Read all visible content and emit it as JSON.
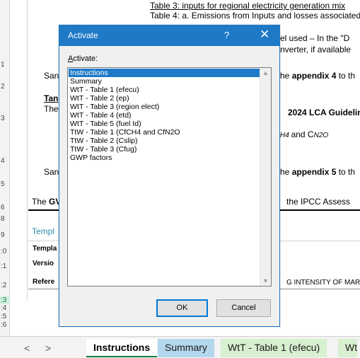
{
  "sheet": {
    "row_numbers": [
      "1",
      "2",
      "3",
      "4",
      "5",
      "6",
      "8",
      "9",
      ":0",
      ":1",
      ":2",
      ":3",
      ":4",
      ":5",
      ":6"
    ],
    "selected_row": ":3",
    "lines": {
      "table3": "Table 3: inputs for regional electricity generation mix",
      "table4": "Table 4: a. Emissions from Inputs and losses associated",
      "fuel_used": "el used – In the \"D",
      "converter": "nverter, if available",
      "san1": "San",
      "appendix4_prefix": "he ",
      "appendix4_bold": "appendix 4",
      "appendix4_suffix": " to th",
      "tan": "Tan",
      "the": "The",
      "lca": "2024 LCA Guidelin",
      "ch4_prefix": "",
      "ch4_text": "and C",
      "ch4_sub1": "H4",
      "ch4_sub2": "N2O",
      "san2": "San",
      "appendix5_prefix": "he ",
      "appendix5_bold": "appendix 5",
      "appendix5_suffix": " to th",
      "the_gv_prefix": "The ",
      "the_gv_bold": "GV",
      "ipcc": "the IPCC Assess",
      "templ": "Templ",
      "templa": "Templa",
      "versio": "Versio",
      "refere": "Refere",
      "intensity": "G INTENSITY OF MARIN"
    }
  },
  "dialog": {
    "title": "Activate",
    "help_label": "?",
    "close_label": "✕",
    "prompt_label": "Activate:",
    "items": [
      "Instructions",
      "Summary",
      "WtT - Table 1 (efecu)",
      "WtT - Table 2 (ep)",
      "WtT - Table 3 (region elect)",
      "WtT - Table 4 (etd)",
      "WtT - Table 5 (fuel Id)",
      "TtW - Table 1 (CfCH4 and CfN2O",
      "TtW - Table 2 (Cslip)",
      "TtW - Table 3 (Cfug)",
      "GWP factors"
    ],
    "selected_index": 0,
    "ok_label": "OK",
    "cancel_label": "Cancel"
  },
  "tabs": {
    "prev_label": "<",
    "next_label": ">",
    "items": [
      "Instructions",
      "Summary",
      "WtT - Table 1 (efecu)",
      "Wt"
    ],
    "active_index": 0
  },
  "colors": {
    "dialog_accent": "#1e79c7",
    "summary_tab": "#b3d7ec",
    "wtt_tab": "#d7f0cf",
    "selected_row": "#107c41"
  }
}
